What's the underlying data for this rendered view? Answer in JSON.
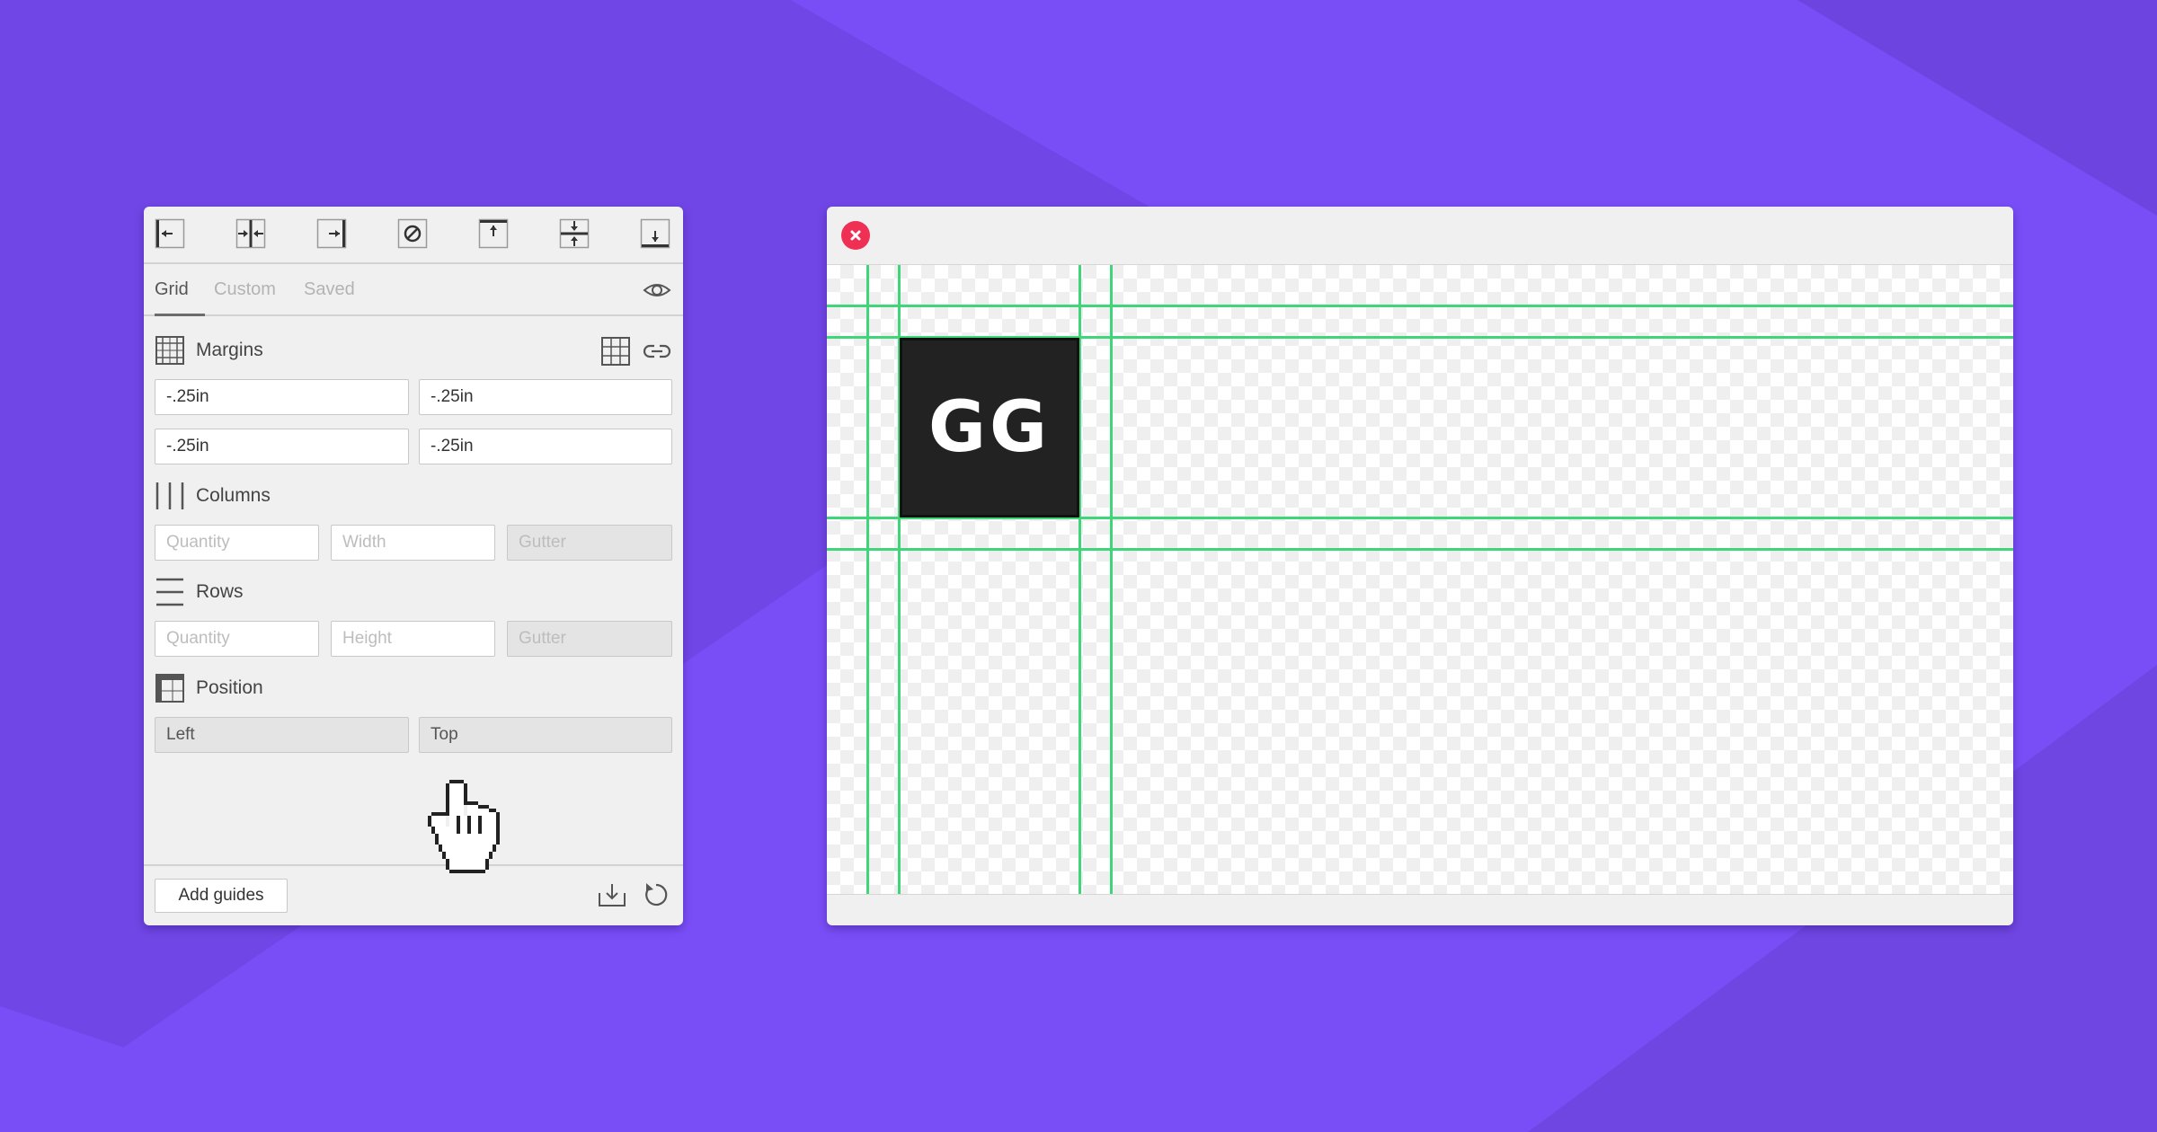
{
  "toolbar": {
    "items": [
      {
        "name": "align-left",
        "icon": "align-left-edge-icon"
      },
      {
        "name": "align-center-vertical",
        "icon": "center-vertical-icon"
      },
      {
        "name": "align-right",
        "icon": "align-right-edge-icon"
      },
      {
        "name": "clear",
        "icon": "no-entry-icon"
      },
      {
        "name": "align-top",
        "icon": "align-top-edge-icon"
      },
      {
        "name": "align-center-horizontal",
        "icon": "center-horizontal-icon"
      },
      {
        "name": "align-bottom",
        "icon": "align-bottom-edge-icon"
      }
    ]
  },
  "tabs": [
    {
      "label": "Grid",
      "active": true
    },
    {
      "label": "Custom",
      "active": false
    },
    {
      "label": "Saved",
      "active": false
    }
  ],
  "sections": {
    "margins": {
      "title": "Margins",
      "values": [
        "-.25in",
        "-.25in",
        "-.25in",
        "-.25in"
      ]
    },
    "columns": {
      "title": "Columns",
      "placeholders": {
        "quantity": "Quantity",
        "width": "Width",
        "gutter": "Gutter"
      }
    },
    "rows": {
      "title": "Rows",
      "placeholders": {
        "quantity": "Quantity",
        "height": "Height",
        "gutter": "Gutter"
      }
    },
    "position": {
      "title": "Position",
      "values": {
        "horizontal": "Left",
        "vertical": "Top"
      }
    }
  },
  "footer": {
    "add_label": "Add guides"
  },
  "canvas": {
    "logo_text": "GG",
    "guide_color": "#3fd67a"
  },
  "colors": {
    "background": "#7a4ef7",
    "close": "#ef2f54"
  }
}
